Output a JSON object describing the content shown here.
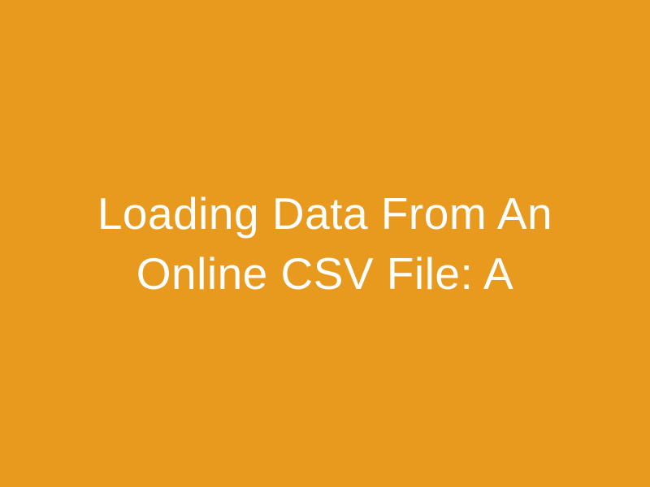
{
  "title": "Loading Data From An Online CSV File: A",
  "colors": {
    "background": "#e89a1e",
    "text": "#ffffff"
  }
}
